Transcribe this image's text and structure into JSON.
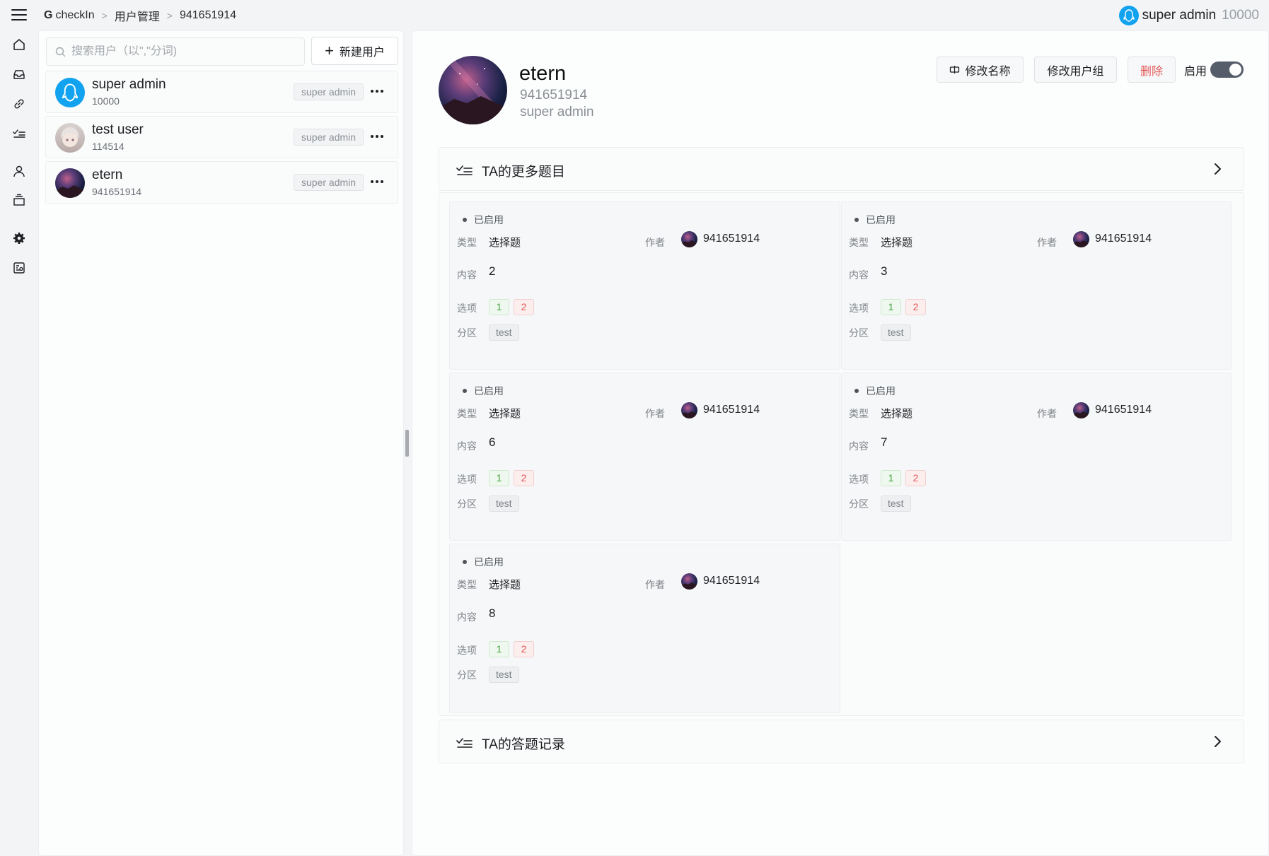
{
  "breadcrumb": {
    "app": "checkIn",
    "section": "用户管理",
    "current": "941651914"
  },
  "current_user": {
    "name": "super admin",
    "id": "10000"
  },
  "rail_icons": [
    "home-icon",
    "inbox-icon",
    "link-icon",
    "checklist-icon",
    "user-icon",
    "layers-icon",
    "gear-icon",
    "dashboard-icon"
  ],
  "users_panel": {
    "search_placeholder": "搜索用户（以\",\"分词)",
    "new_user_label": "新建用户",
    "users": [
      {
        "name": "super admin",
        "id": "10000",
        "group": "super admin",
        "avatar": "qq-avatar"
      },
      {
        "name": "test user",
        "id": "114514",
        "group": "super admin",
        "avatar": "anime-avatar"
      },
      {
        "name": "etern",
        "id": "941651914",
        "group": "super admin",
        "avatar": "galaxy-avatar"
      }
    ]
  },
  "profile": {
    "name": "etern",
    "id": "941651914",
    "group": "super admin",
    "rename_label": "修改名称",
    "change_group_label": "修改用户组",
    "delete_label": "删除",
    "enable_label": "启用",
    "enabled": true
  },
  "questions_section": {
    "title": "TA的更多题目"
  },
  "records_section": {
    "title": "TA的答题记录"
  },
  "card_labels": {
    "status": "已启用",
    "type": "类型",
    "author": "作者",
    "content": "内容",
    "options": "选项",
    "partition": "分区"
  },
  "questions": [
    {
      "status": "已启用",
      "type": "选择题",
      "author": "941651914",
      "content": "2",
      "options": [
        "1",
        "2"
      ],
      "partition": "test"
    },
    {
      "status": "已启用",
      "type": "选择题",
      "author": "941651914",
      "content": "3",
      "options": [
        "1",
        "2"
      ],
      "partition": "test"
    },
    {
      "status": "已启用",
      "type": "选择题",
      "author": "941651914",
      "content": "6",
      "options": [
        "1",
        "2"
      ],
      "partition": "test"
    },
    {
      "status": "已启用",
      "type": "选择题",
      "author": "941651914",
      "content": "7",
      "options": [
        "1",
        "2"
      ],
      "partition": "test"
    },
    {
      "status": "已启用",
      "type": "选择题",
      "author": "941651914",
      "content": "8",
      "options": [
        "1",
        "2"
      ],
      "partition": "test"
    }
  ],
  "colors": {
    "accent_dark": "#555d6b",
    "danger": "#e25a5a",
    "success": "#3ea33e",
    "qq_blue": "#12a3f0"
  }
}
